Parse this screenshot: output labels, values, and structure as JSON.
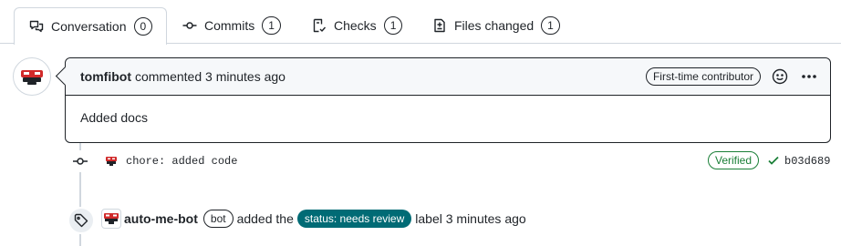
{
  "tabs": [
    {
      "label": "Conversation",
      "count": "0",
      "icon": "comment-discussion-icon"
    },
    {
      "label": "Commits",
      "count": "1",
      "icon": "git-commit-icon"
    },
    {
      "label": "Checks",
      "count": "1",
      "icon": "checklist-icon"
    },
    {
      "label": "Files changed",
      "count": "1",
      "icon": "file-diff-icon"
    }
  ],
  "comment": {
    "author": "tomfibot",
    "meta": "commented 3 minutes ago",
    "badge": "First-time contributor",
    "body": "Added docs"
  },
  "commit": {
    "message": "chore: added code",
    "verified": "Verified",
    "sha": "b03d689"
  },
  "event": {
    "actor": "auto-me-bot",
    "bot_badge": "bot",
    "action": "added the",
    "label": "status: needs review",
    "suffix": "label 3 minutes ago"
  },
  "colors": {
    "label_bg": "#006b75",
    "verified": "#1a7f37",
    "border": "#d0d7de",
    "header_bg": "#f6f8fa"
  }
}
